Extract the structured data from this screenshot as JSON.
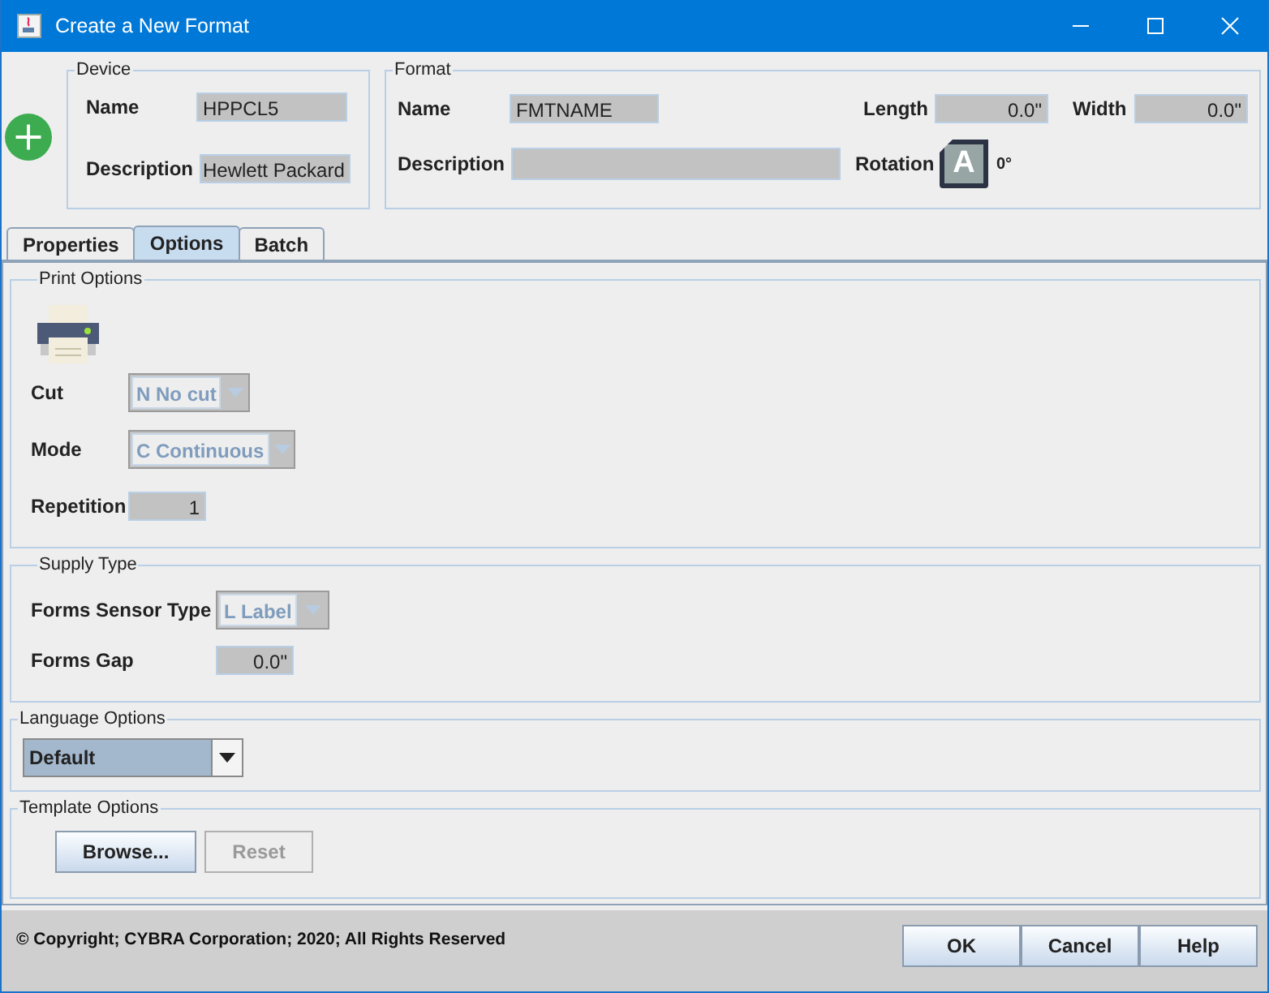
{
  "window": {
    "title": "Create a New Format"
  },
  "device": {
    "legend": "Device",
    "name_label": "Name",
    "name": "HPPCL5",
    "description_label": "Description",
    "description": "Hewlett Packard"
  },
  "format": {
    "legend": "Format",
    "name_label": "Name",
    "name": "FMTNAME",
    "description_label": "Description",
    "length_label": "Length",
    "length": "0.0\"",
    "width_label": "Width",
    "width": "0.0\"",
    "rotation_label": "Rotation",
    "rotation_glyph": "A",
    "rotation": "0°"
  },
  "tabs": [
    {
      "label": "Properties",
      "selected": false
    },
    {
      "label": "Options",
      "selected": true
    },
    {
      "label": "Batch",
      "selected": false
    }
  ],
  "print_options": {
    "legend": "Print Options",
    "fields": [
      {
        "kind": "combo",
        "label": "Cut",
        "value": "N No cut",
        "disabled": true
      },
      {
        "kind": "combo",
        "label": "Mode",
        "value": "C Continuous",
        "disabled": true
      },
      {
        "kind": "number",
        "label": "Repetition",
        "value": "1"
      }
    ]
  },
  "supply_type": {
    "legend": "Supply Type",
    "fields": [
      {
        "kind": "combo",
        "label": "Forms Sensor Type",
        "value": "L Label",
        "disabled": true
      },
      {
        "kind": "number",
        "label": "Forms Gap",
        "value": "0.0\""
      }
    ]
  },
  "language_options": {
    "legend": "Language Options",
    "value": "Default"
  },
  "template_options": {
    "legend": "Template Options",
    "buttons": [
      {
        "label": "Browse...",
        "disabled": false
      },
      {
        "label": "Reset",
        "disabled": true
      }
    ]
  },
  "status": "© Copyright; CYBRA Corporation; 2020; All Rights Reserved",
  "buttons": [
    "OK",
    "Cancel",
    "Help"
  ]
}
